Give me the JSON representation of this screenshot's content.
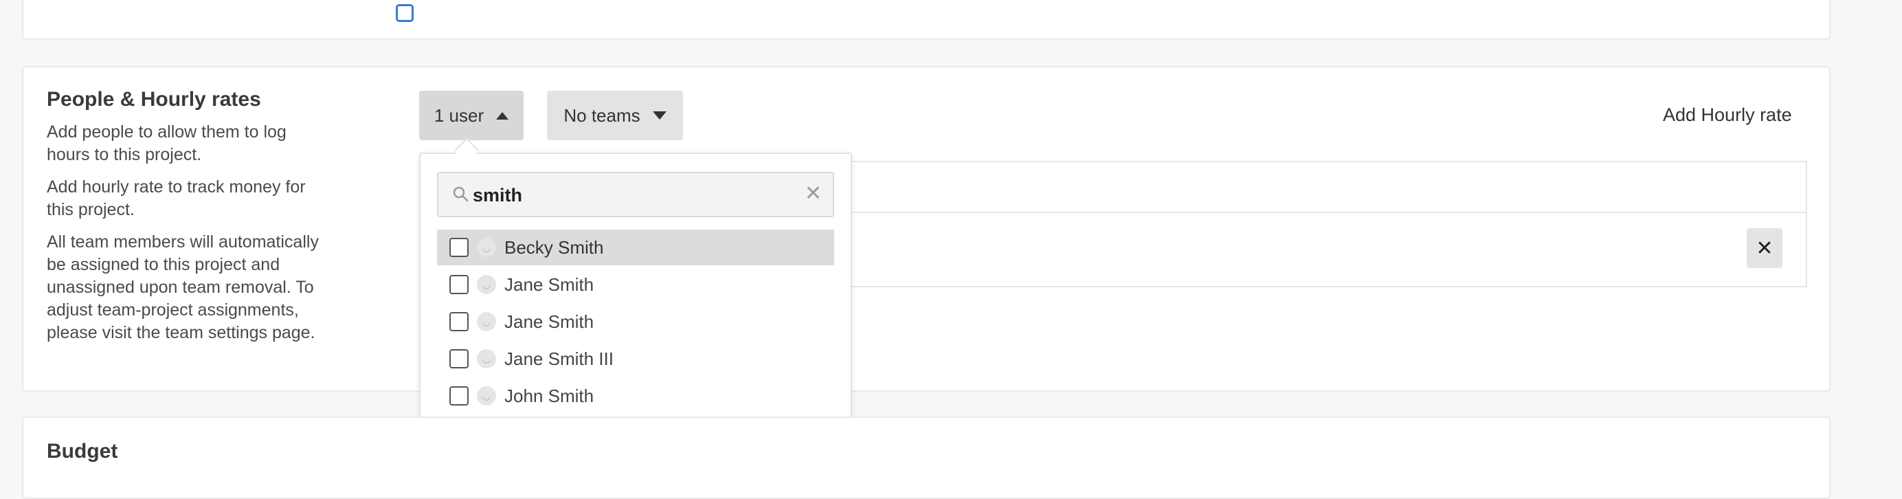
{
  "people_section": {
    "title": "People & Hourly rates",
    "description": [
      "Add people to allow them to log hours to this project.",
      "Add hourly rate to track money for this project.",
      "All team members will automatically be assigned to this project and unassigned upon team removal. To adjust team-project assignments, please visit the team settings page."
    ],
    "users_button": "1 user",
    "teams_button": "No teams",
    "add_rate_label": "Add Hourly rate",
    "remove_label": "✕"
  },
  "user_dropdown": {
    "search_value": "smith",
    "clear_label": "✕",
    "results": [
      {
        "name": "Becky Smith",
        "highlighted": true
      },
      {
        "name": "Jane Smith",
        "highlighted": false
      },
      {
        "name": "Jane Smith",
        "highlighted": false
      },
      {
        "name": "Jane Smith III",
        "highlighted": false
      },
      {
        "name": "John Smith",
        "highlighted": false
      }
    ]
  },
  "budget_section": {
    "title": "Budget"
  },
  "colors": {
    "checkbox_accent": "#3a7bd5",
    "highlight_row": "#dcdcdc"
  },
  "icons": [
    "search-icon",
    "caret-up-icon",
    "caret-down-icon",
    "close-icon",
    "avatar-icon"
  ]
}
